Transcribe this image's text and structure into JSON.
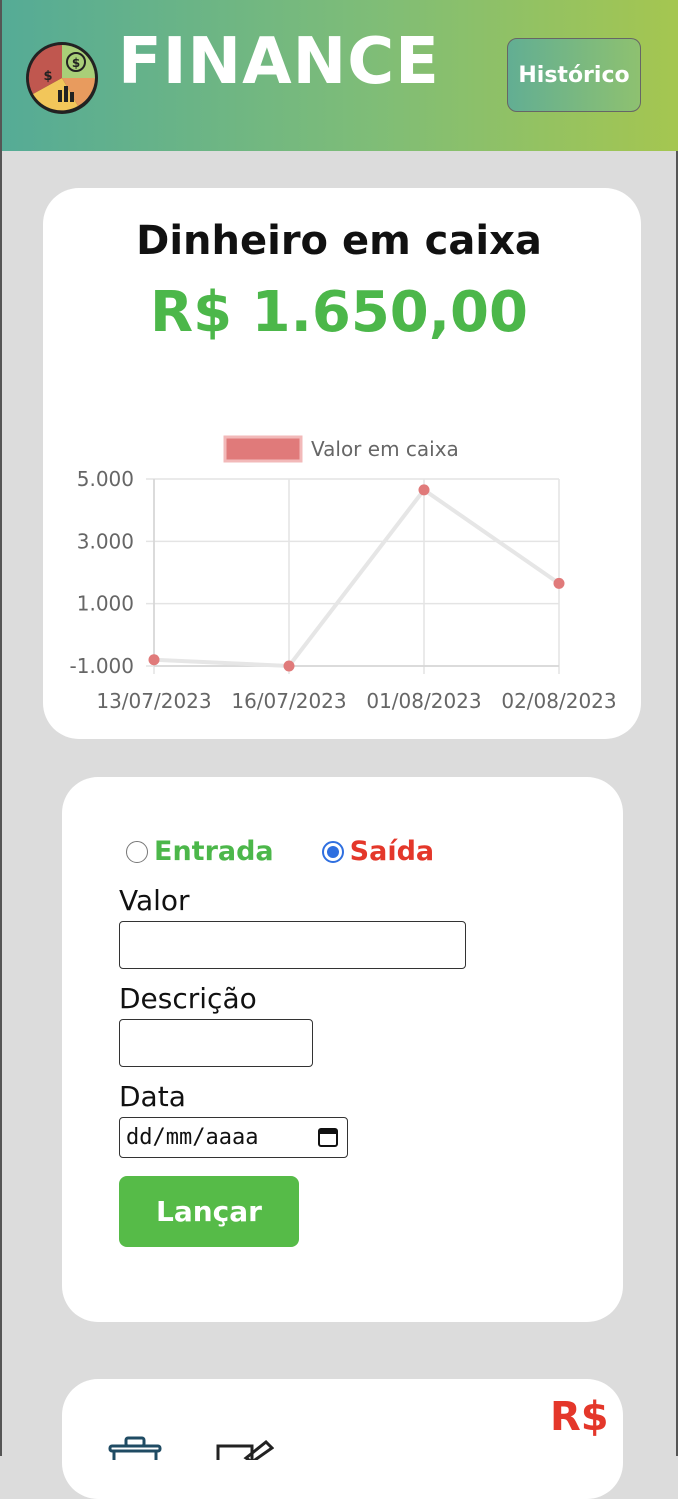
{
  "header": {
    "brand": "FINANCE",
    "history_button": "Histórico"
  },
  "cash": {
    "title": "Dinheiro em caixa",
    "value": "R$ 1.650,00"
  },
  "chart_data": {
    "type": "line",
    "series": [
      {
        "name": "Valor em caixa",
        "values": [
          -800,
          -1000,
          4650,
          1650
        ]
      }
    ],
    "categories": [
      "13/07/2023",
      "16/07/2023",
      "01/08/2023",
      "02/08/2023"
    ],
    "yticks": [
      "5.000",
      "3.000",
      "1.000",
      "-1.000"
    ],
    "ylim": [
      -1000,
      5000
    ],
    "grid": true,
    "legend": "top",
    "colors": {
      "point": "#e07a7a",
      "line": "#e6e6e6"
    }
  },
  "form": {
    "type_options": [
      {
        "label": "Entrada",
        "checked": false,
        "color": "#4cb74a"
      },
      {
        "label": "Saída",
        "checked": true,
        "color": "#e4372a"
      }
    ],
    "valor_label": "Valor",
    "descricao_label": "Descrição",
    "data_label": "Data",
    "date_placeholder": "dd/mm/aaaa",
    "submit_label": "Lançar"
  },
  "entry": {
    "currency": "R$"
  }
}
